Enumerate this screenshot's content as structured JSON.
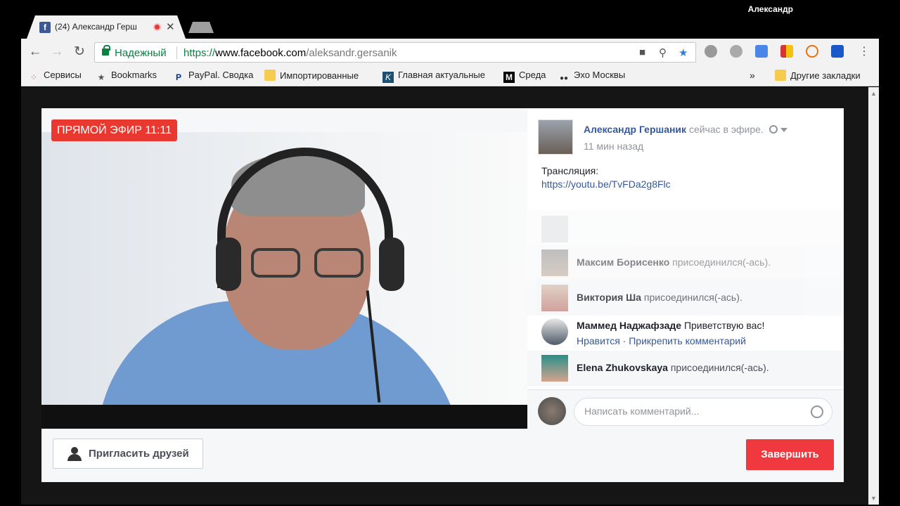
{
  "window": {
    "user_name": "Александр"
  },
  "tab": {
    "title": "(24) Александр Герш",
    "favicon": "f"
  },
  "toolbar": {
    "secure_label": "Надежный",
    "url_scheme": "https://",
    "url_host": "www.facebook.com",
    "url_path": "/aleksandr.gersanik"
  },
  "bookmarks": [
    {
      "label": "Сервисы",
      "icon": "apps-icon"
    },
    {
      "label": "Bookmarks",
      "icon": "star-icon"
    },
    {
      "label": "PayPal. Сводка",
      "icon": "paypal-icon"
    },
    {
      "label": "Импортированные",
      "icon": "folder-icon"
    },
    {
      "label": "Главная актуальные",
      "icon": "k-icon"
    },
    {
      "label": "Среда",
      "icon": "medium-icon"
    },
    {
      "label": "Эхо Москвы",
      "icon": "echo-icon"
    }
  ],
  "bookmarks_overflow": "»",
  "bookmarks_other": "Другие закладки",
  "live": {
    "badge": "ПРЯМОЙ ЭФИР 11:11"
  },
  "post": {
    "author": "Александр Гершаник",
    "status": "сейчас в эфире.",
    "time": "11 мин назад",
    "text": "Трансляция:",
    "link": "https://youtu.be/TvFDa2g8Flc"
  },
  "activity": [
    {
      "name": "Максим Борисенко",
      "action": "присоединился(-ась).",
      "faded": true
    },
    {
      "name": "Виктория Ша",
      "action": "присоединился(-ась).",
      "faded": false
    },
    {
      "name": "Маммед Наджафзаде",
      "action": "Приветствую вас!",
      "like": "Нравится",
      "pin": "Прикрепить комментарий"
    },
    {
      "name": "Elena Zhukovskaya",
      "action": "присоединился(-ась).",
      "faded": false
    }
  ],
  "comment": {
    "placeholder": "Написать комментарий..."
  },
  "footer": {
    "invite_label": "Пригласить друзей",
    "end_label": "Завершить"
  },
  "colors": {
    "live_red": "#e9382f",
    "end_red": "#f0383f",
    "fb_link": "#365899",
    "secure_green": "#0b8043"
  }
}
